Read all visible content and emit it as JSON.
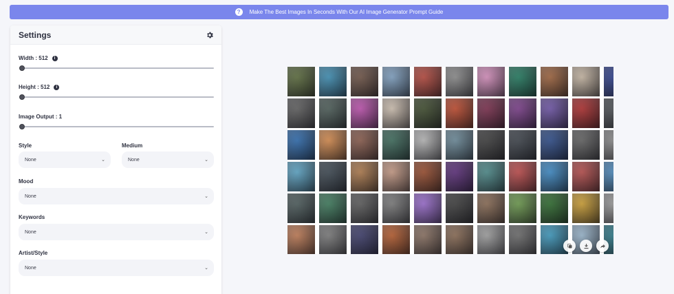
{
  "banner": {
    "icon": "question-icon",
    "text": "Make The Best Images In Seconds With Our AI Image Generator Prompt Guide"
  },
  "settings": {
    "title": "Settings",
    "width_label": "Width : 512",
    "height_label": "Height : 512",
    "output_label": "Image Output : 1",
    "style_label": "Style",
    "style_value": "None",
    "medium_label": "Medium",
    "medium_value": "None",
    "mood_label": "Mood",
    "mood_value": "None",
    "keywords_label": "Keywords",
    "keywords_value": "None",
    "artist_label": "Artist/Style",
    "artist_value": "None",
    "sliders": {
      "width": 0,
      "height": 0,
      "output": 0
    }
  },
  "gallery": {
    "colors": [
      [
        "#5a6b3a",
        "#3b8fb6",
        "#6e5244",
        "#7fa2c4",
        "#b8463a",
        "#8c8c8c",
        "#d98fbf",
        "#1e7a5e",
        "#a0623a",
        "#c9b8a4",
        "#2b3d8e"
      ],
      [
        "#5d5d5d",
        "#4a5b56",
        "#c04fb0",
        "#d1c2b2",
        "#3c4a2a",
        "#c2482a",
        "#7a2a4a",
        "#7a3a8a",
        "#6d52a8",
        "#b02a2a",
        "#4a4e52"
      ],
      [
        "#2a6ab0",
        "#d88a4a",
        "#8a5a4a",
        "#3a6a5a",
        "#b8b8b8",
        "#6a8a9a",
        "#3a3a3a",
        "#3a4048",
        "#2a4a8a",
        "#606060",
        "#8a8a8a"
      ],
      [
        "#5aa6c8",
        "#3a4650",
        "#b07a4a",
        "#c89a84",
        "#9a4a2a",
        "#5a2a7a",
        "#4a8a8a",
        "#c04848",
        "#3a8ac8",
        "#b84a48",
        "#4a8ac0"
      ],
      [
        "#4a5a5a",
        "#3a7a5a",
        "#5a5a5a",
        "#7a7a7a",
        "#9a6ad0",
        "#3a3a3a",
        "#8a6a52",
        "#6a9a4a",
        "#2a6a2a",
        "#d0a030",
        "#9a9a9a"
      ],
      [
        "#c27a52",
        "#7a7a7a",
        "#3a3a6a",
        "#b85a2a",
        "#8a7060",
        "#8a6a52",
        "#a0a0a0",
        "#6a6a6a",
        "#3a9ac0",
        "#9ab8d0",
        "#2a7a8a"
      ]
    ],
    "actions": [
      "copy-icon",
      "download-icon",
      "share-icon"
    ]
  }
}
